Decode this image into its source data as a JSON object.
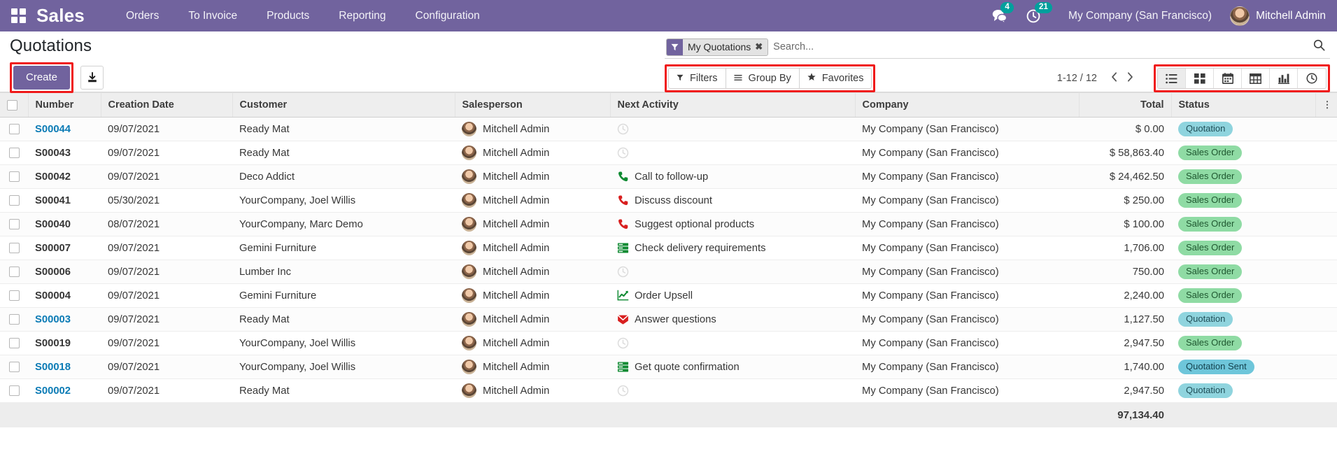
{
  "navbar": {
    "apps_icon": "apps-grid-icon",
    "brand": "Sales",
    "menus": [
      "Orders",
      "To Invoice",
      "Products",
      "Reporting",
      "Configuration"
    ],
    "messages_icon": "messages-icon",
    "messages_count": "4",
    "activities_icon": "activities-clock-icon",
    "activities_count": "21",
    "company": "My Company (San Francisco)",
    "user": "Mitchell Admin",
    "brand_color": "#71639e",
    "badge_color": "#00a09d"
  },
  "control_panel": {
    "title": "Quotations",
    "create_label": "Create",
    "import_icon": "import-download-icon",
    "highlight_color": "#f01a1a",
    "search": {
      "facet_icon": "filter-funnel-icon",
      "facet_label": "My Quotations",
      "facet_remove_icon": "close-x-icon",
      "placeholder": "Search...",
      "value": "",
      "magnifier_icon": "search-icon"
    },
    "filters_label": "Filters",
    "filters_icon": "filter-funnel-icon",
    "groupby_label": "Group By",
    "groupby_icon": "hamburger-lines-icon",
    "favorites_label": "Favorites",
    "favorites_icon": "star-icon",
    "pager": "1-12 / 12",
    "prev_icon": "chevron-left-icon",
    "next_icon": "chevron-right-icon",
    "views": [
      {
        "name": "list-view",
        "icon": "list-icon",
        "active": true
      },
      {
        "name": "kanban-view",
        "icon": "kanban-grid-icon",
        "active": false
      },
      {
        "name": "calendar-view",
        "icon": "calendar-icon",
        "active": false
      },
      {
        "name": "pivot-view",
        "icon": "pivot-table-icon",
        "active": false
      },
      {
        "name": "graph-view",
        "icon": "bar-chart-icon",
        "active": false
      },
      {
        "name": "activity-view",
        "icon": "clock-icon",
        "active": false
      }
    ]
  },
  "table": {
    "columns": [
      "Number",
      "Creation Date",
      "Customer",
      "Salesperson",
      "Next Activity",
      "Company",
      "Total",
      "Status"
    ],
    "optional_icon": "column-options-icon",
    "rows": [
      {
        "number": "S00044",
        "date": "09/07/2021",
        "customer": "Ready Mat",
        "salesperson": "Mitchell Admin",
        "activity": "",
        "activity_icon": "clock-empty-icon",
        "company": "My Company (San Francisco)",
        "total": "$ 0.00",
        "status": "Quotation",
        "status_type": "quotation",
        "highlight": true
      },
      {
        "number": "S00043",
        "date": "09/07/2021",
        "customer": "Ready Mat",
        "salesperson": "Mitchell Admin",
        "activity": "",
        "activity_icon": "clock-empty-icon",
        "company": "My Company (San Francisco)",
        "total": "$ 58,863.40",
        "status": "Sales Order",
        "status_type": "sales",
        "highlight": false
      },
      {
        "number": "S00042",
        "date": "09/07/2021",
        "customer": "Deco Addict",
        "salesperson": "Mitchell Admin",
        "activity": "Call to follow-up",
        "activity_icon": "phone-green-icon",
        "company": "My Company (San Francisco)",
        "total": "$ 24,462.50",
        "status": "Sales Order",
        "status_type": "sales",
        "highlight": false
      },
      {
        "number": "S00041",
        "date": "05/30/2021",
        "customer": "YourCompany, Joel Willis",
        "salesperson": "Mitchell Admin",
        "activity": "Discuss discount",
        "activity_icon": "phone-red-icon",
        "company": "My Company (San Francisco)",
        "total": "$ 250.00",
        "status": "Sales Order",
        "status_type": "sales",
        "highlight": false
      },
      {
        "number": "S00040",
        "date": "08/07/2021",
        "customer": "YourCompany, Marc Demo",
        "salesperson": "Mitchell Admin",
        "activity": "Suggest optional products",
        "activity_icon": "phone-red-icon",
        "company": "My Company (San Francisco)",
        "total": "$ 100.00",
        "status": "Sales Order",
        "status_type": "sales",
        "highlight": false
      },
      {
        "number": "S00007",
        "date": "09/07/2021",
        "customer": "Gemini Furniture",
        "salesperson": "Mitchell Admin",
        "activity": "Check delivery requirements",
        "activity_icon": "server-green-icon",
        "company": "My Company (San Francisco)",
        "total": "1,706.00",
        "status": "Sales Order",
        "status_type": "sales",
        "highlight": false
      },
      {
        "number": "S00006",
        "date": "09/07/2021",
        "customer": "Lumber Inc",
        "salesperson": "Mitchell Admin",
        "activity": "",
        "activity_icon": "clock-empty-icon",
        "company": "My Company (San Francisco)",
        "total": "750.00",
        "status": "Sales Order",
        "status_type": "sales",
        "highlight": false
      },
      {
        "number": "S00004",
        "date": "09/07/2021",
        "customer": "Gemini Furniture",
        "salesperson": "Mitchell Admin",
        "activity": "Order Upsell",
        "activity_icon": "line-chart-green-icon",
        "company": "My Company (San Francisco)",
        "total": "2,240.00",
        "status": "Sales Order",
        "status_type": "sales",
        "highlight": false
      },
      {
        "number": "S00003",
        "date": "09/07/2021",
        "customer": "Ready Mat",
        "salesperson": "Mitchell Admin",
        "activity": "Answer questions",
        "activity_icon": "envelope-red-icon",
        "company": "My Company (San Francisco)",
        "total": "1,127.50",
        "status": "Quotation",
        "status_type": "quotation",
        "highlight": true
      },
      {
        "number": "S00019",
        "date": "09/07/2021",
        "customer": "YourCompany, Joel Willis",
        "salesperson": "Mitchell Admin",
        "activity": "",
        "activity_icon": "clock-empty-icon",
        "company": "My Company (San Francisco)",
        "total": "2,947.50",
        "status": "Sales Order",
        "status_type": "sales",
        "highlight": false
      },
      {
        "number": "S00018",
        "date": "09/07/2021",
        "customer": "YourCompany, Joel Willis",
        "salesperson": "Mitchell Admin",
        "activity": "Get quote confirmation",
        "activity_icon": "server-green-icon",
        "company": "My Company (San Francisco)",
        "total": "1,740.00",
        "status": "Quotation Sent",
        "status_type": "sent",
        "highlight": true
      },
      {
        "number": "S00002",
        "date": "09/07/2021",
        "customer": "Ready Mat",
        "salesperson": "Mitchell Admin",
        "activity": "",
        "activity_icon": "clock-empty-icon",
        "company": "My Company (San Francisco)",
        "total": "2,947.50",
        "status": "Quotation",
        "status_type": "quotation",
        "highlight": true
      }
    ],
    "footer_total": "97,134.40"
  }
}
